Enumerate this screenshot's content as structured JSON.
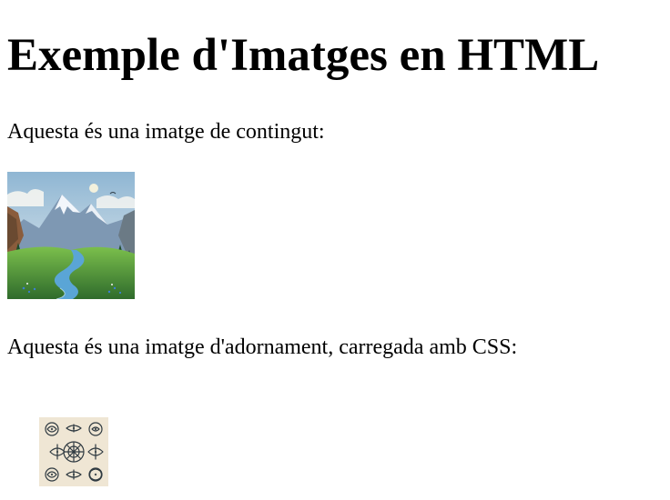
{
  "page": {
    "title": "Exemple d'Imatges en HTML",
    "paragraph_content": "Aquesta és una imatge de contingut:",
    "paragraph_decoration": "Aquesta és una imatge d'adornament, carregada amb CSS:"
  },
  "images": {
    "content_image": "landscape-mountain-image",
    "decoration_image": "ornament-tiles-image"
  },
  "colors": {
    "background": "#ffffff",
    "text": "#000000",
    "sky": "#b9d4e6",
    "mountain": "#7f97b4",
    "grass": "#4f9b3b",
    "river": "#5aa5d6",
    "ornament_bg": "#efe6d4",
    "ornament_ink": "#2f3a41"
  }
}
